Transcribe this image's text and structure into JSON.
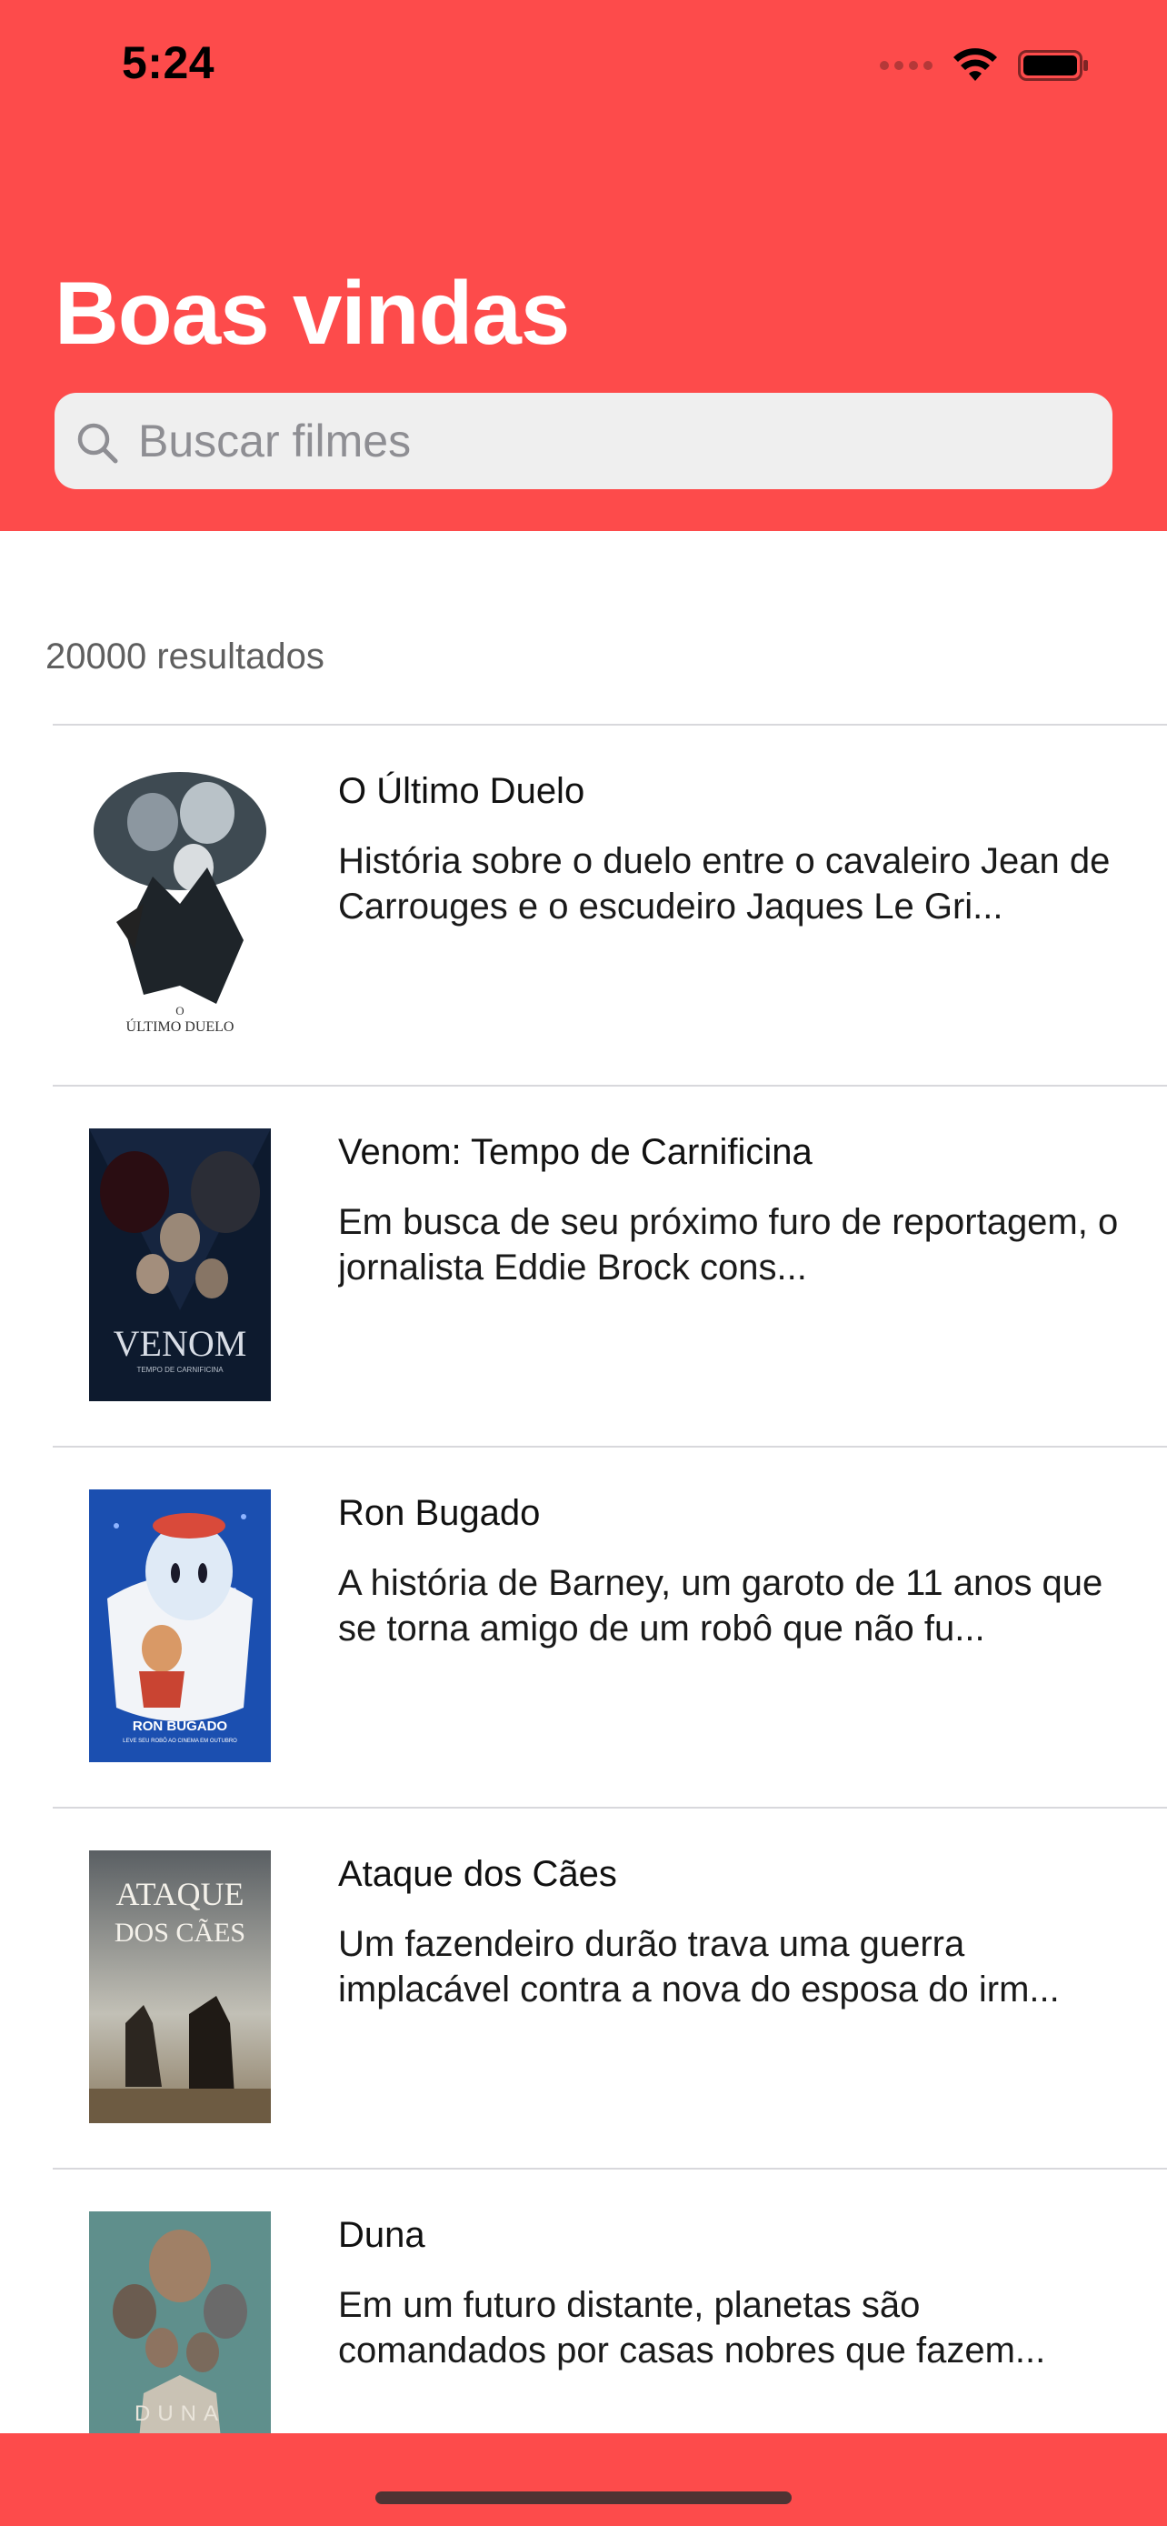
{
  "status_bar": {
    "time": "5:24"
  },
  "header": {
    "title": "Boas vindas",
    "search_placeholder": "Buscar filmes",
    "accent_color": "#fd4b4b"
  },
  "results": {
    "count_label": "20000 resultados"
  },
  "movies": [
    {
      "title": "O Último Duelo",
      "overview": "História sobre o duelo entre o cavaleiro Jean de Carrouges e o escudeiro Jaques Le Gri...",
      "poster_text": [
        "O",
        "ÚLTIMO DUELO"
      ]
    },
    {
      "title": "Venom: Tempo de Carnificina",
      "overview": "Em busca de seu próximo furo de reportagem, o jornalista Eddie Brock cons...",
      "poster_text": [
        "VENOM",
        "TEMPO DE CARNIFICINA"
      ]
    },
    {
      "title": "Ron Bugado",
      "overview": "A história de Barney, um garoto de 11 anos que se torna amigo de um robô que não fu...",
      "poster_text": [
        "RON BUGADO",
        "LEVE SEU ROBÔ AO CINEMA EM OUTUBRO"
      ]
    },
    {
      "title": "Ataque dos Cães",
      "overview": "Um fazendeiro durão trava uma guerra implacável contra a nova do esposa do irm...",
      "poster_text": [
        "ATAQUE",
        "DOS CÃES"
      ]
    },
    {
      "title": "Duna",
      "overview": "Em um futuro distante, planetas são comandados por casas nobres que fazem...",
      "poster_text": [
        "DUNA"
      ]
    }
  ]
}
